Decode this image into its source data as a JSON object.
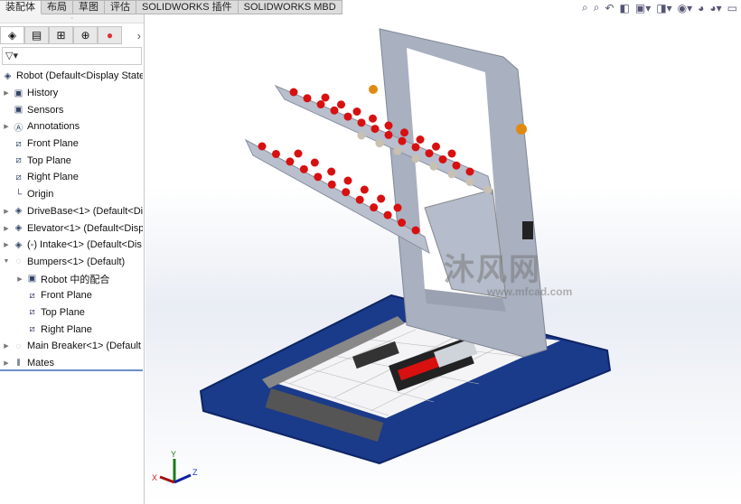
{
  "tabs": [
    "装配体",
    "布局",
    "草图",
    "评估",
    "SOLIDWORKS 插件",
    "SOLIDWORKS MBD"
  ],
  "active_tab": "装配体",
  "panel_tabs": [
    {
      "icon": "feature-manager-icon"
    },
    {
      "icon": "property-manager-icon"
    },
    {
      "icon": "configuration-manager-icon"
    },
    {
      "icon": "dimxpert-icon"
    },
    {
      "icon": "display-manager-icon"
    }
  ],
  "panel_more": "›",
  "filter": {
    "icon": "filter-icon",
    "label": "▽▾"
  },
  "tree": [
    {
      "label": "Robot  (Default<Display State",
      "icon": "assembly-icon",
      "level": 0,
      "expander": ""
    },
    {
      "label": "History",
      "icon": "history-folder-icon",
      "level": 1,
      "expander": "▶"
    },
    {
      "label": "Sensors",
      "icon": "sensors-folder-icon",
      "level": 1,
      "expander": ""
    },
    {
      "label": "Annotations",
      "icon": "annotations-folder-icon",
      "level": 1,
      "expander": "▶"
    },
    {
      "label": "Front Plane",
      "icon": "plane-icon",
      "level": 1,
      "expander": ""
    },
    {
      "label": "Top Plane",
      "icon": "plane-icon",
      "level": 1,
      "expander": ""
    },
    {
      "label": "Right Plane",
      "icon": "plane-icon",
      "level": 1,
      "expander": ""
    },
    {
      "label": "Origin",
      "icon": "origin-icon",
      "level": 1,
      "expander": ""
    },
    {
      "label": "DriveBase<1> (Default<Di",
      "icon": "subassembly-icon",
      "level": 1,
      "expander": "▶"
    },
    {
      "label": "Elevator<1> (Default<Disp",
      "icon": "subassembly-icon",
      "level": 1,
      "expander": "▶"
    },
    {
      "label": "(-) Intake<1> (Default<Dis",
      "icon": "subassembly-icon",
      "level": 1,
      "expander": "▶"
    },
    {
      "label": "Bumpers<1> (Default)",
      "icon": "suppressed-assembly-icon",
      "level": 1,
      "expander": "▼"
    },
    {
      "label": "Robot 中的配合",
      "icon": "mates-folder-icon",
      "level": 2,
      "expander": "▶"
    },
    {
      "label": "Front Plane",
      "icon": "plane-icon",
      "level": 2,
      "expander": ""
    },
    {
      "label": "Top Plane",
      "icon": "plane-icon",
      "level": 2,
      "expander": ""
    },
    {
      "label": "Right Plane",
      "icon": "plane-icon",
      "level": 2,
      "expander": ""
    },
    {
      "label": "Main Breaker<1> (Default",
      "icon": "suppressed-assembly-icon",
      "level": 1,
      "expander": "▶"
    },
    {
      "label": "Mates",
      "icon": "mates-icon",
      "level": 1,
      "expander": "▶"
    }
  ],
  "toolbar_icons": [
    "zoom-to-fit-icon",
    "zoom-to-area-icon",
    "previous-view-icon",
    "section-view-icon",
    "view-orientation-icon",
    "display-style-icon",
    "hide-show-icon",
    "edit-appearance-icon",
    "apply-scene-icon",
    "view-settings-icon"
  ],
  "watermark": {
    "brand": "沐风网",
    "url": "www.mfcad.com"
  },
  "triad": {
    "x": "X",
    "y": "Y",
    "z": "Z"
  },
  "colors": {
    "bumper": "#1a3a8a",
    "frame": "#a9b0c0",
    "roller": "#d81010",
    "selection": "#6b8fc7"
  }
}
